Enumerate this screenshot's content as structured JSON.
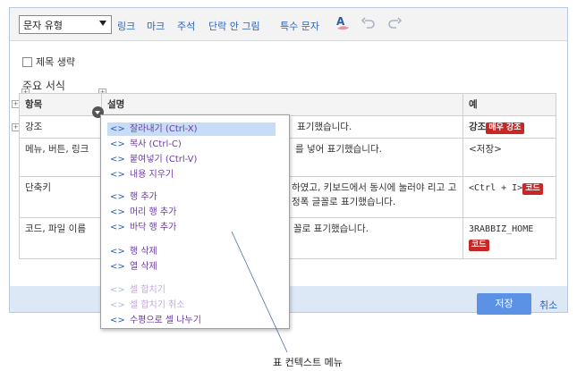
{
  "toolbar": {
    "style_select": "문자 유형",
    "links": [
      "링크",
      "마크",
      "주석",
      "단락 안 그림",
      "특수 문자"
    ],
    "icons": [
      "text-color-icon",
      "undo-icon",
      "redo-icon"
    ]
  },
  "content": {
    "omit_title_label": "제목 생략",
    "section_title": "주요 서식",
    "table": {
      "headers": [
        "항목",
        "설명",
        "예"
      ],
      "rows": [
        {
          "item": "강조",
          "desc": "표기했습니다.",
          "example": "강조",
          "badge": "매우 강조"
        },
        {
          "item": "메뉴, 버튼, 링크",
          "desc": "를 넣어 표기했습니다.",
          "example": "<저장>",
          "badge": ""
        },
        {
          "item": "단축키",
          "desc": "하였고, 키보드에서 동시에 눌러야 리고 고정폭 글꼴로 표기했습니다.",
          "example": "<Ctrl + I>",
          "badge": "코드"
        },
        {
          "item": "코드, 파일 이름",
          "desc": "꼴로 표기했습니다.",
          "example": "3RABBIZ_HOME",
          "badge": "코드"
        }
      ]
    }
  },
  "context_menu": {
    "items": [
      {
        "label": "잘라내기 (Ctrl-X)",
        "state": "selected"
      },
      {
        "label": "복사 (Ctrl-C)",
        "state": "normal"
      },
      {
        "label": "붙여넣기 (Ctrl-V)",
        "state": "normal"
      },
      {
        "label": "내용 지우기",
        "state": "normal"
      },
      {
        "label": "행 추가",
        "state": "normal"
      },
      {
        "label": "머리 행 추가",
        "state": "normal"
      },
      {
        "label": "바닥 행 추가",
        "state": "normal"
      },
      {
        "label": "행 삭제",
        "state": "normal"
      },
      {
        "label": "열 삭제",
        "state": "normal"
      },
      {
        "label": "셀 합치기",
        "state": "disabled"
      },
      {
        "label": "셀 합치기 취소",
        "state": "disabled"
      },
      {
        "label": "수평으로 셀 나누기",
        "state": "normal"
      }
    ],
    "item_icon": "<>"
  },
  "footer": {
    "save_label": "저장",
    "cancel_label": "취소"
  },
  "annotation": {
    "callout_label": "표 컨텍스트 메뉴"
  },
  "colors": {
    "accent": "#5b92e5",
    "link": "#2a64b8",
    "menu_text": "#6a3ba0",
    "badge": "#c62828"
  }
}
